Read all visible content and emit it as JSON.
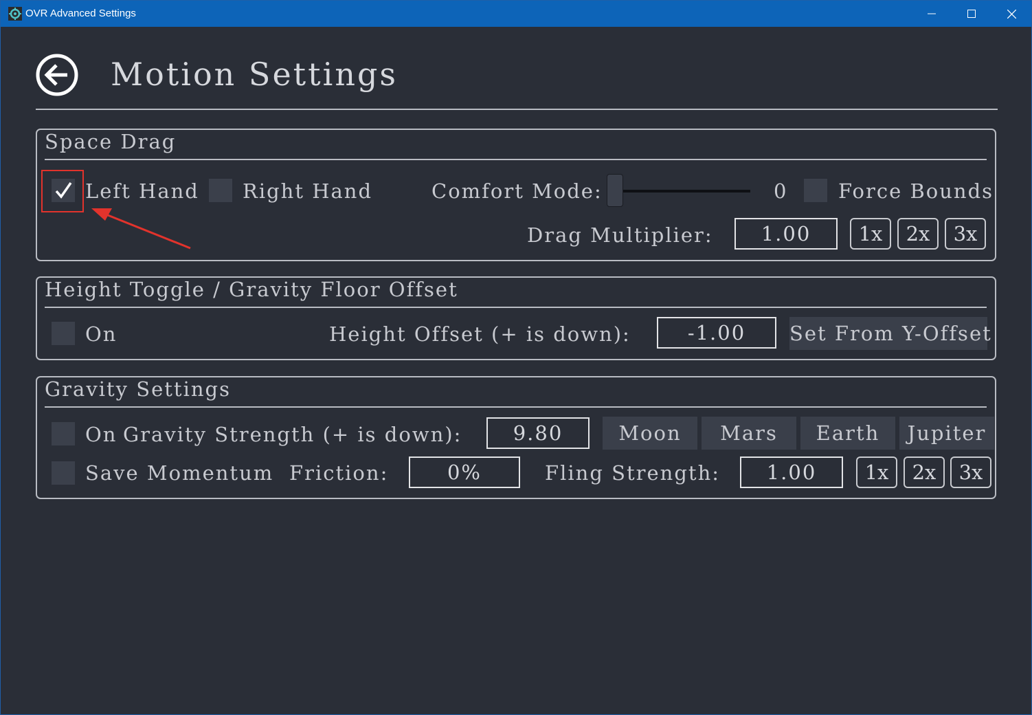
{
  "window": {
    "title": "OVR Advanced Settings",
    "titlebar_color": "#0d64b8",
    "background_color": "#2a2e37"
  },
  "header": {
    "title": "Motion Settings",
    "back_icon": "back-arrow-circle-icon"
  },
  "space_drag": {
    "title": "Space Drag",
    "left_hand": {
      "label": "Left Hand",
      "checked": true
    },
    "right_hand": {
      "label": "Right Hand",
      "checked": false
    },
    "comfort_mode": {
      "label": "Comfort Mode:",
      "value": "0",
      "slider_fraction": 0
    },
    "force_bounds": {
      "label": "Force Bounds",
      "checked": false
    },
    "drag_multiplier": {
      "label": "Drag Multiplier:",
      "value": "1.00"
    },
    "multipliers": [
      "1x",
      "2x",
      "3x"
    ]
  },
  "height_toggle": {
    "title": "Height Toggle / Gravity Floor Offset",
    "on": {
      "label": "On",
      "checked": false
    },
    "height_offset": {
      "label": "Height Offset (+ is down):",
      "value": "-1.00"
    },
    "set_from_button": "Set From Y-Offset"
  },
  "gravity": {
    "title": "Gravity Settings",
    "on": {
      "label": "On",
      "checked": false
    },
    "strength": {
      "label": "Gravity Strength (+ is down):",
      "value": "9.80"
    },
    "presets": [
      "Moon",
      "Mars",
      "Earth",
      "Jupiter"
    ],
    "save_momentum": {
      "label": "Save Momentum",
      "checked": false
    },
    "friction": {
      "label": "Friction:",
      "value": "0%"
    },
    "fling_strength": {
      "label": "Fling Strength:",
      "value": "1.00"
    },
    "fling_multipliers": [
      "1x",
      "2x",
      "3x"
    ]
  },
  "annotation": {
    "color": "#e2332c"
  }
}
